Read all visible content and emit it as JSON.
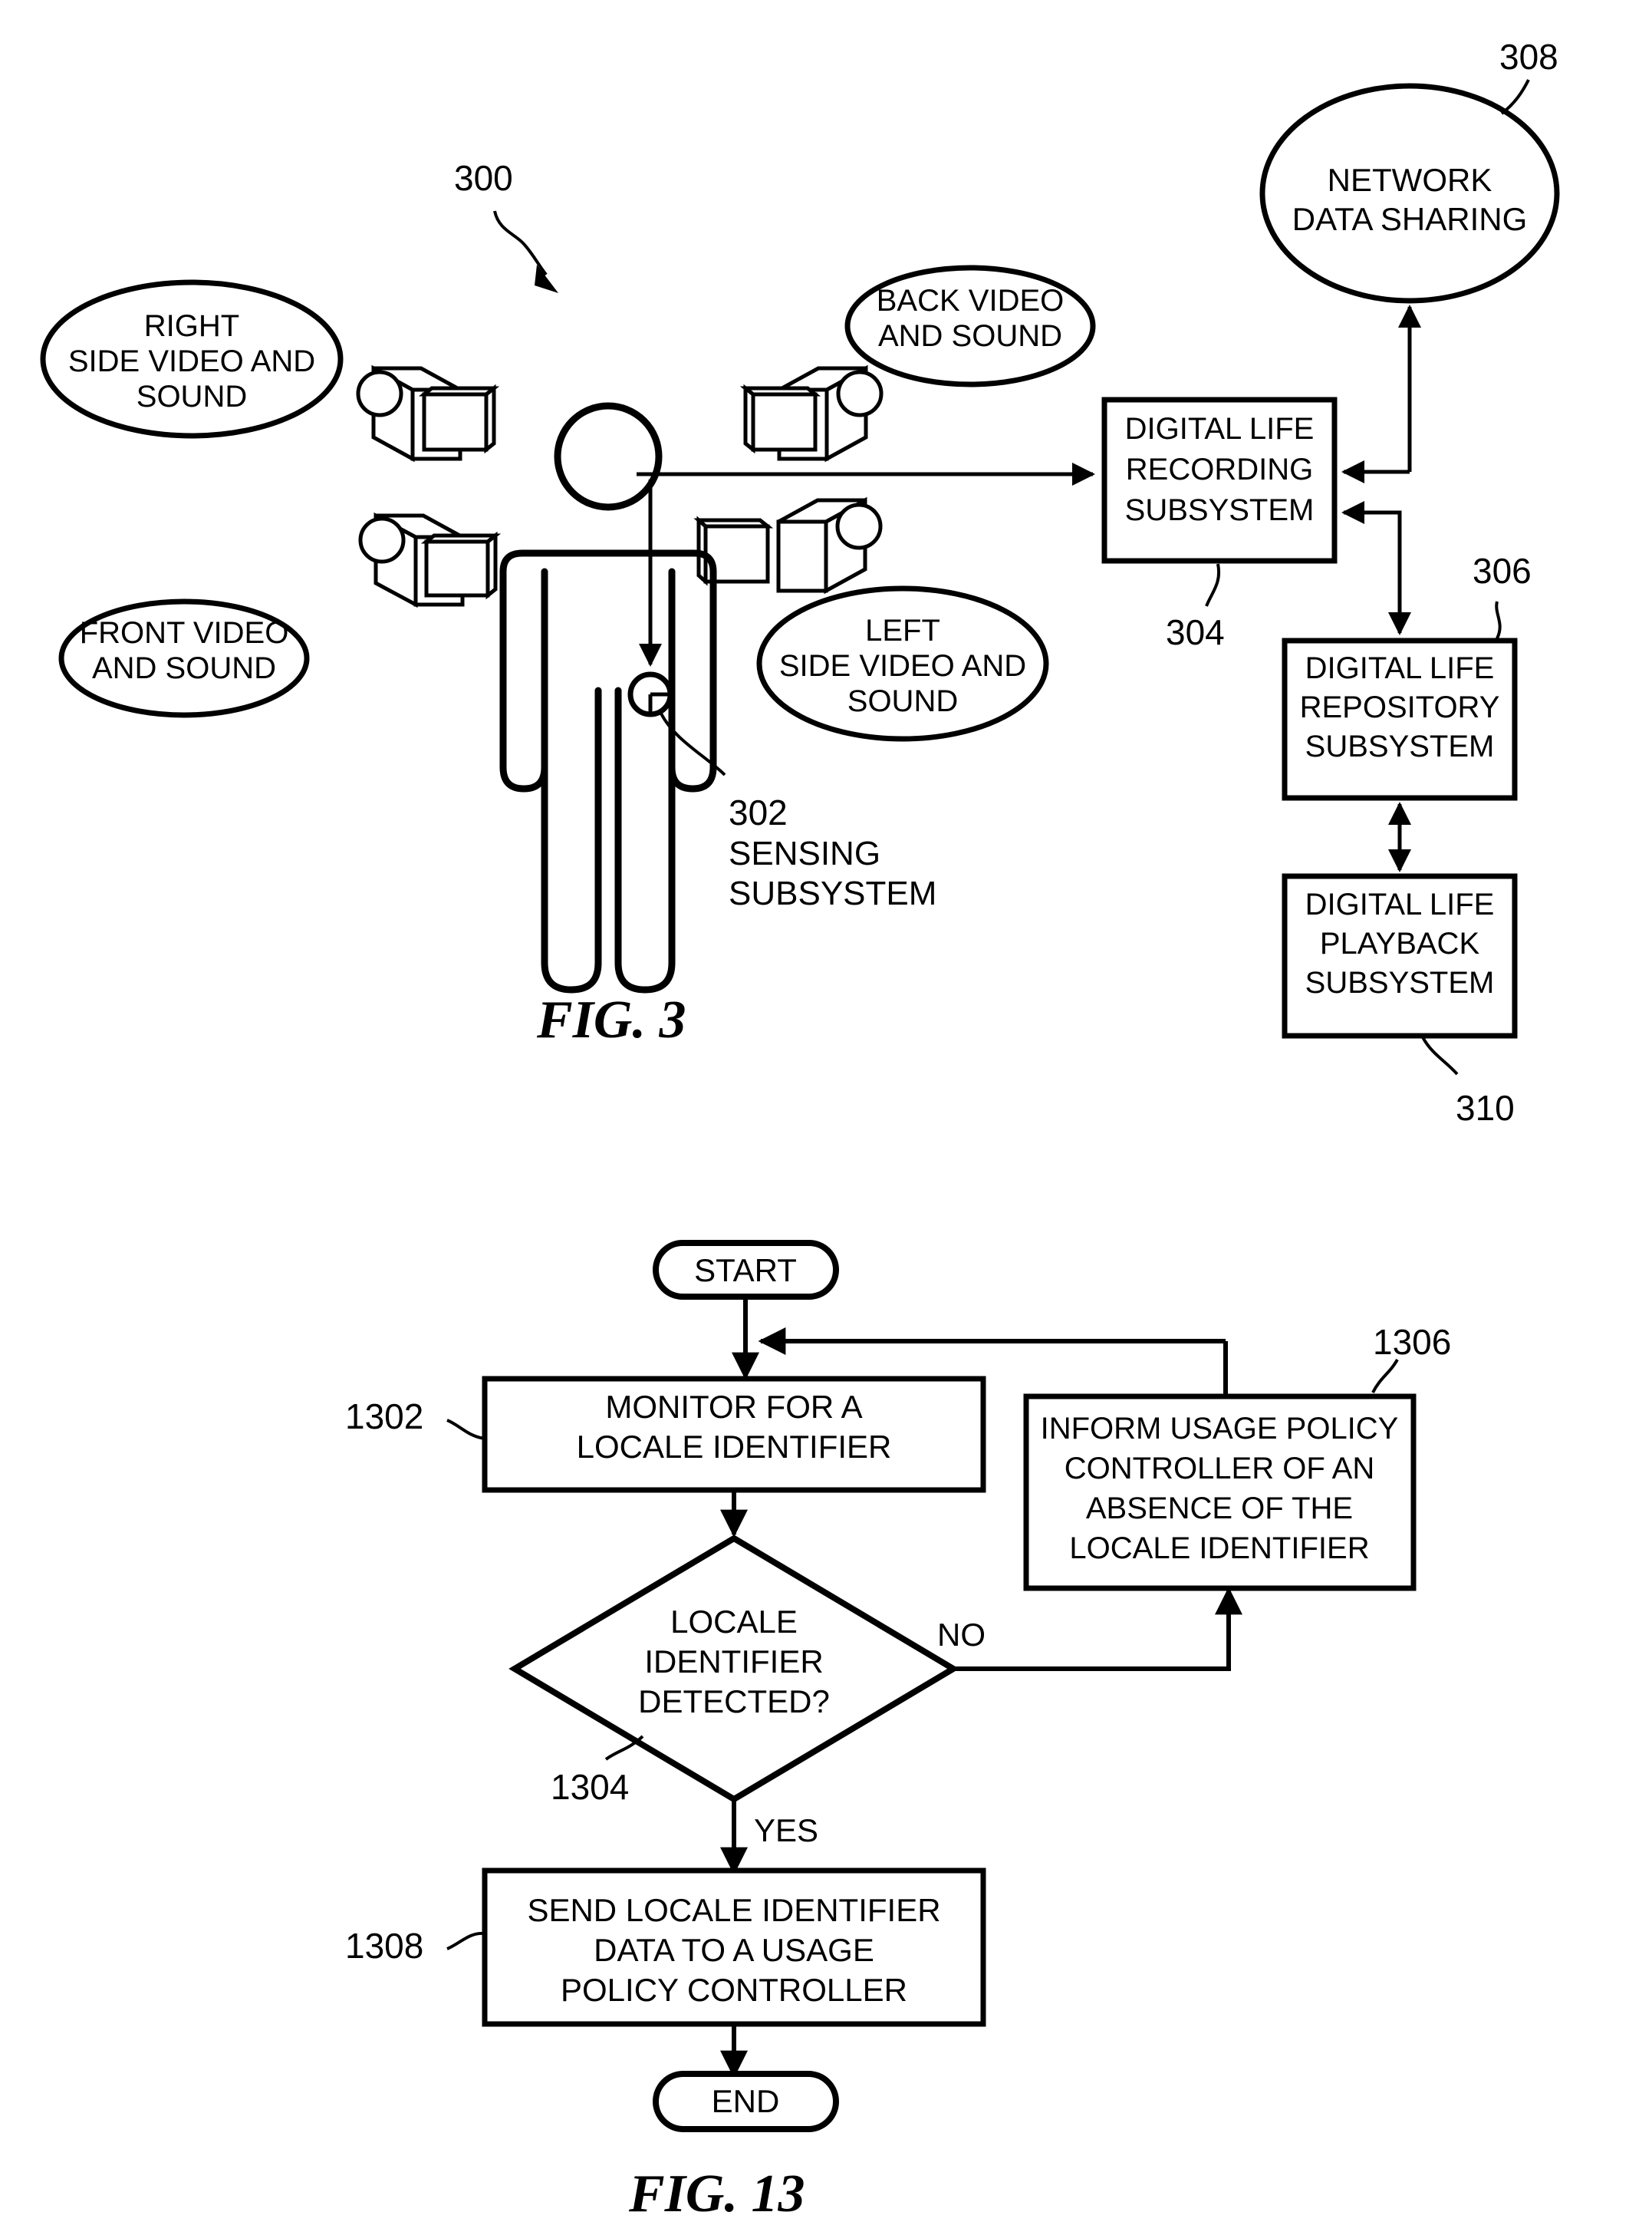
{
  "figures": [
    {
      "id": "fig3",
      "caption": "FIG. 3",
      "ref_number": "300",
      "nodes": {
        "right_video": "RIGHT\nSIDE VIDEO AND\nSOUND",
        "right_video_l1": "RIGHT",
        "right_video_l2": "SIDE VIDEO AND",
        "right_video_l3": "SOUND",
        "back_video_l1": "BACK VIDEO",
        "back_video_l2": "AND SOUND",
        "front_video_l1": "FRONT VIDEO",
        "front_video_l2": "AND SOUND",
        "left_video_l1": "LEFT",
        "left_video_l2": "SIDE VIDEO AND",
        "left_video_l3": "SOUND",
        "network_l1": "NETWORK",
        "network_l2": "DATA SHARING",
        "recording_l1": "DIGITAL LIFE",
        "recording_l2": "RECORDING",
        "recording_l3": "SUBSYSTEM",
        "repository_l1": "DIGITAL LIFE",
        "repository_l2": "REPOSITORY",
        "repository_l3": "SUBSYSTEM",
        "playback_l1": "DIGITAL LIFE",
        "playback_l2": "PLAYBACK",
        "playback_l3": "SUBSYSTEM",
        "sensing_num": "302",
        "sensing_l1": "SENSING",
        "sensing_l2": "SUBSYSTEM"
      },
      "ref_labels": {
        "recording": "304",
        "repository": "306",
        "network": "308",
        "playback": "310"
      }
    },
    {
      "id": "fig13",
      "caption": "FIG. 13",
      "nodes": {
        "start": "START",
        "end": "END",
        "monitor_l1": "MONITOR FOR A",
        "monitor_l2": "LOCALE IDENTIFIER",
        "decision_l1": "LOCALE",
        "decision_l2": "IDENTIFIER",
        "decision_l3": "DETECTED?",
        "inform_l1": "INFORM USAGE POLICY",
        "inform_l2": "CONTROLLER OF AN",
        "inform_l3": "ABSENCE OF THE",
        "inform_l4": "LOCALE IDENTIFIER",
        "send_l1": "SEND LOCALE IDENTIFIER",
        "send_l2": "DATA TO A USAGE",
        "send_l3": "POLICY CONTROLLER"
      },
      "edge_labels": {
        "no": "NO",
        "yes": "YES"
      },
      "ref_labels": {
        "monitor": "1302",
        "decision": "1304",
        "inform": "1306",
        "send": "1308"
      }
    }
  ],
  "style": {
    "ink": "#000000",
    "paper": "#ffffff"
  }
}
